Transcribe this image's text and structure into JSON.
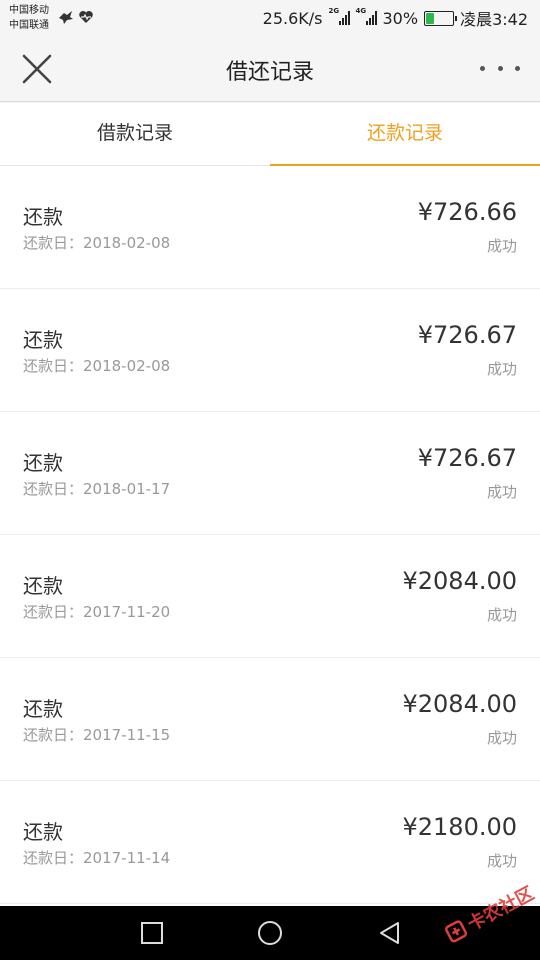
{
  "status_bar": {
    "carrier_1": "中国移动",
    "carrier_2": "中国联通",
    "net_speed": "25.6K/s",
    "signal_1_label": "2G",
    "signal_2_label": "4G",
    "battery": "30%",
    "battery_level": 0.3,
    "time": "凌晨3:42"
  },
  "header": {
    "title": "借还记录"
  },
  "tabs": [
    {
      "label": "借款记录",
      "active": false
    },
    {
      "label": "还款记录",
      "active": true
    }
  ],
  "records": [
    {
      "type": "还款",
      "date": "还款日：2018-02-08",
      "amount": "¥726.66",
      "status": "成功"
    },
    {
      "type": "还款",
      "date": "还款日：2018-02-08",
      "amount": "¥726.67",
      "status": "成功"
    },
    {
      "type": "还款",
      "date": "还款日：2018-01-17",
      "amount": "¥726.67",
      "status": "成功"
    },
    {
      "type": "还款",
      "date": "还款日：2017-11-20",
      "amount": "¥2084.00",
      "status": "成功"
    },
    {
      "type": "还款",
      "date": "还款日：2017-11-15",
      "amount": "¥2084.00",
      "status": "成功"
    },
    {
      "type": "还款",
      "date": "还款日：2017-11-14",
      "amount": "¥2180.00",
      "status": "成功"
    }
  ],
  "watermark": {
    "text": "卡农社区"
  },
  "colors": {
    "accent": "#f0a020",
    "battery_fill": "#2db84d"
  }
}
